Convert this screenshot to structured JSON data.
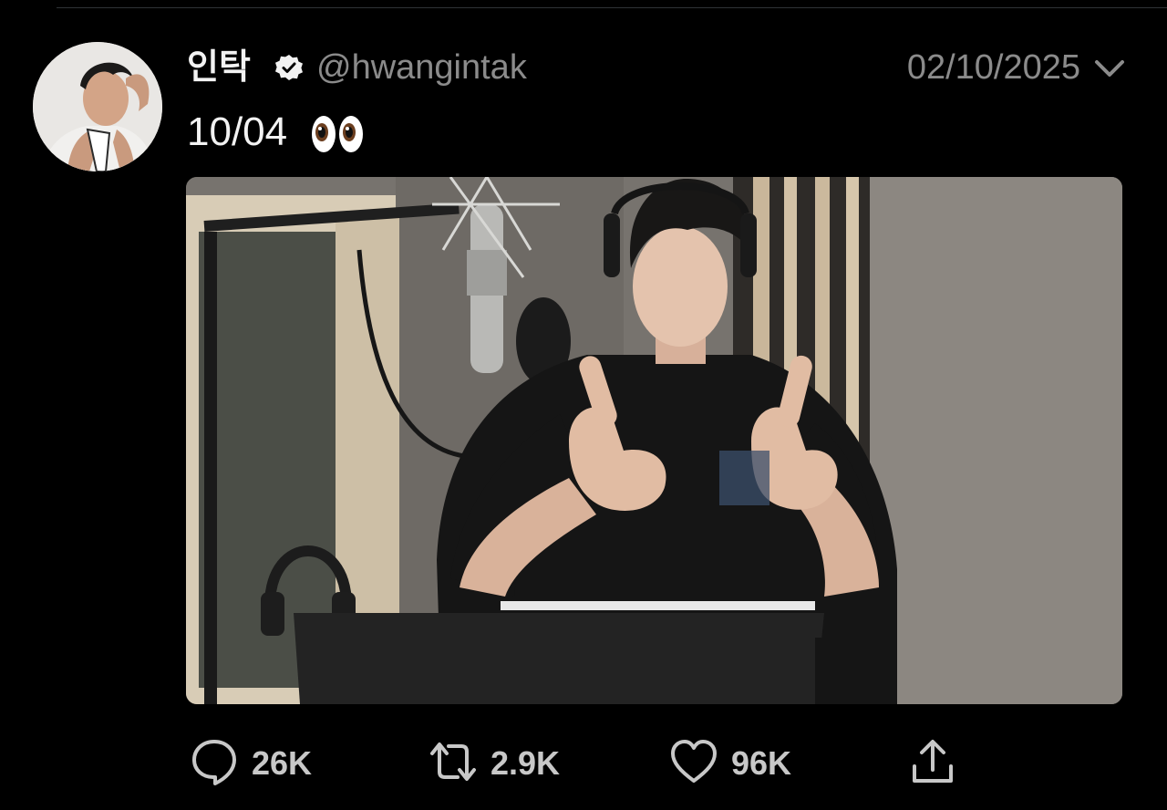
{
  "tweet": {
    "display_name": "인탁",
    "handle": "@hwangintak",
    "timestamp": "02/10/2025",
    "text": "10/04",
    "emoji": "eyes-emoji"
  },
  "actions": {
    "replies": "26K",
    "retweets": "2.9K",
    "likes": "96K"
  },
  "icons": {
    "verified": "verified-badge-icon",
    "more": "chevron-down-icon",
    "reply": "reply-icon",
    "retweet": "retweet-icon",
    "like": "heart-icon",
    "share": "share-icon"
  },
  "colors": {
    "background": "#000000",
    "text": "#f2f2f2",
    "muted": "#8b8b8b",
    "divider": "#2f3336"
  }
}
